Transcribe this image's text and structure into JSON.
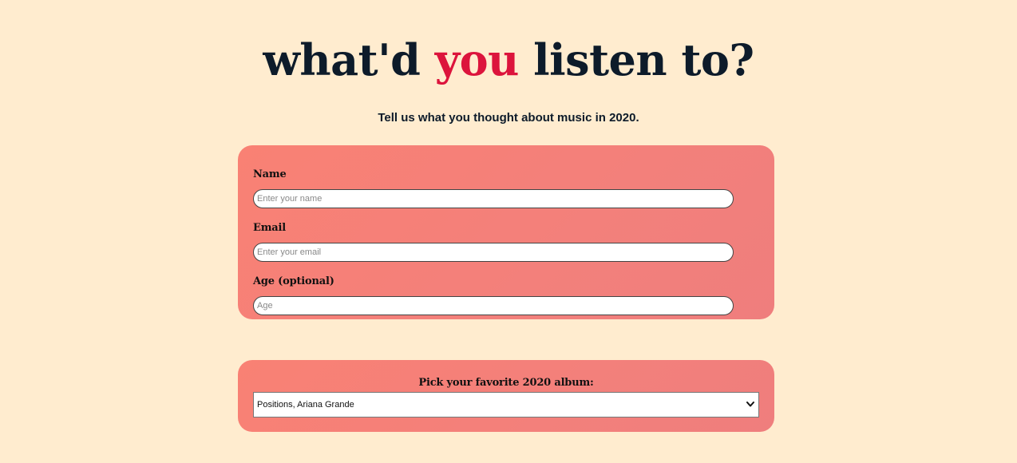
{
  "header": {
    "title_before": "what'd ",
    "title_accent": "you",
    "title_after": " listen to?",
    "subtitle": "Tell us what you thought about music in 2020."
  },
  "info_form": {
    "name": {
      "label": "Name",
      "placeholder": "Enter your name",
      "value": ""
    },
    "email": {
      "label": "Email",
      "placeholder": "Enter your email",
      "value": ""
    },
    "age": {
      "label": "Age (optional)",
      "placeholder": "Age",
      "value": ""
    }
  },
  "album_form": {
    "label": "Pick your favorite 2020 album:",
    "selected": "Positions, Ariana Grande",
    "icon": "chevron-down-icon"
  },
  "colors": {
    "background": "#ffeccf",
    "card": "#f68079",
    "accent": "#dc143c",
    "text": "#0d1b2a"
  }
}
